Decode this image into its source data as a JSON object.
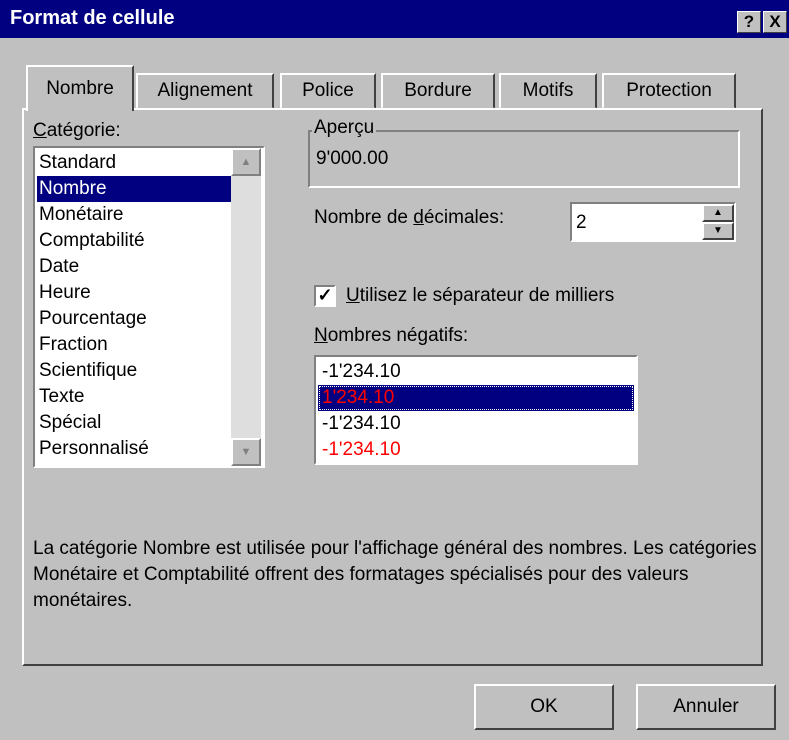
{
  "window": {
    "title": "Format de cellule",
    "help_label": "?",
    "close_label": "X"
  },
  "tabs": [
    "Nombre",
    "Alignement",
    "Police",
    "Bordure",
    "Motifs",
    "Protection"
  ],
  "category": {
    "label": "Catégorie:",
    "items": [
      "Standard",
      "Nombre",
      "Monétaire",
      "Comptabilité",
      "Date",
      "Heure",
      "Pourcentage",
      "Fraction",
      "Scientifique",
      "Texte",
      "Spécial",
      "Personnalisé"
    ],
    "selected": "Nombre"
  },
  "preview": {
    "label": "Aperçu",
    "value": "9'000.00"
  },
  "decimals": {
    "label": "Nombre de décimales:",
    "value": "2"
  },
  "thousands": {
    "label": "Utilisez le séparateur de milliers",
    "checked": true
  },
  "negatives": {
    "label": "Nombres négatifs:",
    "items": [
      "-1'234.10",
      "1'234.10",
      "-1'234.10",
      "-1'234.10"
    ],
    "selected_index": 1
  },
  "description": "La catégorie Nombre est utilisée pour l'affichage général des nombres. Les catégories Monétaire et Comptabilité offrent des formatages spécialisés pour des valeurs monétaires.",
  "buttons": {
    "ok": "OK",
    "cancel": "Annuler"
  },
  "colors": {
    "titlebar": "#000080",
    "selection": "#000080",
    "negative_red": "#ff0000",
    "face": "#c0c0c0"
  }
}
